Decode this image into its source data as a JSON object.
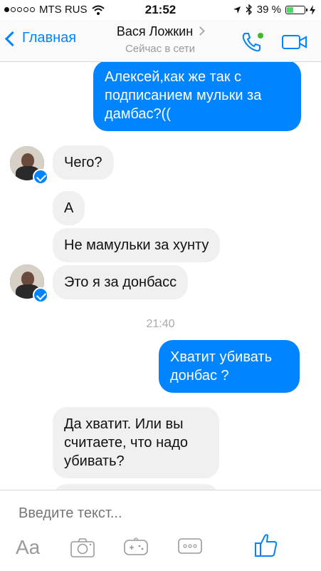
{
  "status_bar": {
    "carrier": "MTS RUS",
    "time": "21:52",
    "battery": "39 %",
    "battery_level": 0.39
  },
  "header": {
    "back_label": "Главная",
    "contact_name": "Вася Ложкин",
    "status": "Сейчас в сети"
  },
  "messages": [
    {
      "from": "me",
      "text": "Алексей,как же так с подписанием мульки за дамбас?(("
    },
    {
      "from": "them",
      "text": "Чего?"
    },
    {
      "from": "them",
      "text": "А"
    },
    {
      "from": "them",
      "text": "Не мамульки за хунту"
    },
    {
      "from": "them",
      "text": "Это я за донбасс"
    },
    {
      "from": "me",
      "text": "Хватит убивать донбас ?"
    },
    {
      "from": "them",
      "text": "Да хватит. Или вы считаете, что надо убивать?"
    }
  ],
  "timestamp": "21:40",
  "composer": {
    "placeholder": "Введите текст...",
    "aa_label": "Aa"
  },
  "colors": {
    "accent": "#0084ff",
    "incoming_bubble": "#f1f0f0",
    "battery_fill": "#4cd964"
  }
}
